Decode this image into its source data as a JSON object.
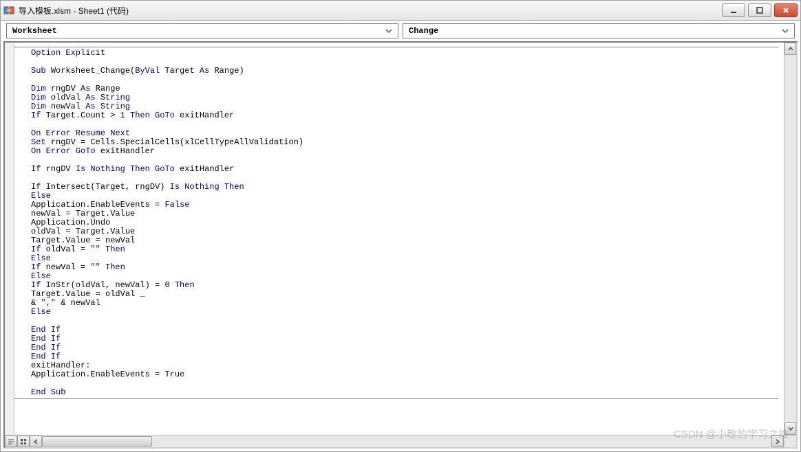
{
  "window": {
    "title": "导入模板.xlsm - Sheet1 (代码)"
  },
  "dropdowns": {
    "object": "Worksheet",
    "procedure": "Change"
  },
  "code": {
    "lines": [
      [
        {
          "t": "Option Explicit",
          "c": "k"
        }
      ],
      [],
      [
        {
          "t": "Sub ",
          "c": "k"
        },
        {
          "t": "Worksheet_Change(",
          "c": "c"
        },
        {
          "t": "ByVal",
          "c": "k"
        },
        {
          "t": " Target ",
          "c": "c"
        },
        {
          "t": "As",
          "c": "k"
        },
        {
          "t": " Range)",
          "c": "c"
        }
      ],
      [],
      [
        {
          "t": "Dim ",
          "c": "k"
        },
        {
          "t": "rngDV ",
          "c": "c"
        },
        {
          "t": "As",
          "c": "k"
        },
        {
          "t": " Range",
          "c": "c"
        }
      ],
      [
        {
          "t": "Dim ",
          "c": "k"
        },
        {
          "t": "oldVal ",
          "c": "c"
        },
        {
          "t": "As String",
          "c": "k"
        }
      ],
      [
        {
          "t": "Dim ",
          "c": "k"
        },
        {
          "t": "newVal ",
          "c": "c"
        },
        {
          "t": "As String",
          "c": "k"
        }
      ],
      [
        {
          "t": "If ",
          "c": "k"
        },
        {
          "t": "Target.Count > 1 ",
          "c": "c"
        },
        {
          "t": "Then GoTo",
          "c": "k"
        },
        {
          "t": " exitHandler",
          "c": "c"
        }
      ],
      [],
      [
        {
          "t": "On Error Resume Next",
          "c": "k"
        }
      ],
      [
        {
          "t": "Set ",
          "c": "k"
        },
        {
          "t": "rngDV = Cells.SpecialCells(xlCellTypeAllValidation)",
          "c": "c"
        }
      ],
      [
        {
          "t": "On Error GoTo",
          "c": "k"
        },
        {
          "t": " exitHandler",
          "c": "c"
        }
      ],
      [],
      [
        {
          "t": "If ",
          "c": "k"
        },
        {
          "t": "rngDV ",
          "c": "c"
        },
        {
          "t": "Is Nothing Then GoTo",
          "c": "k"
        },
        {
          "t": " exitHandler",
          "c": "c"
        }
      ],
      [],
      [
        {
          "t": "If ",
          "c": "k"
        },
        {
          "t": "Intersect(Target, rngDV) ",
          "c": "c"
        },
        {
          "t": "Is Nothing Then",
          "c": "k"
        }
      ],
      [
        {
          "t": "Else",
          "c": "k"
        }
      ],
      [
        {
          "t": "Application.EnableEvents = ",
          "c": "c"
        },
        {
          "t": "False",
          "c": "k"
        }
      ],
      [
        {
          "t": "newVal = Target.Value",
          "c": "c"
        }
      ],
      [
        {
          "t": "Application.Undo",
          "c": "c"
        }
      ],
      [
        {
          "t": "oldVal = Target.Value",
          "c": "c"
        }
      ],
      [
        {
          "t": "Target.Value = newVal",
          "c": "c"
        }
      ],
      [
        {
          "t": "If ",
          "c": "k"
        },
        {
          "t": "oldVal = ",
          "c": "c"
        },
        {
          "t": "\"\"",
          "c": "s"
        },
        {
          "t": " Then",
          "c": "k"
        }
      ],
      [
        {
          "t": "Else",
          "c": "k"
        }
      ],
      [
        {
          "t": "If ",
          "c": "k"
        },
        {
          "t": "newVal = ",
          "c": "c"
        },
        {
          "t": "\"\"",
          "c": "s"
        },
        {
          "t": " Then",
          "c": "k"
        }
      ],
      [
        {
          "t": "Else",
          "c": "k"
        }
      ],
      [
        {
          "t": "If ",
          "c": "k"
        },
        {
          "t": "InStr(oldVal, newVal) = 0 ",
          "c": "c"
        },
        {
          "t": "Then",
          "c": "k"
        }
      ],
      [
        {
          "t": "Target.Value = oldVal _",
          "c": "c"
        }
      ],
      [
        {
          "t": "& ",
          "c": "c"
        },
        {
          "t": "\",\"",
          "c": "s"
        },
        {
          "t": " & newVal",
          "c": "c"
        }
      ],
      [
        {
          "t": "Else",
          "c": "k"
        }
      ],
      [],
      [
        {
          "t": "End If",
          "c": "k"
        }
      ],
      [
        {
          "t": "End If",
          "c": "k"
        }
      ],
      [
        {
          "t": "End If",
          "c": "k"
        }
      ],
      [
        {
          "t": "End If",
          "c": "k"
        }
      ],
      [
        {
          "t": "exitHandler:",
          "c": "c"
        }
      ],
      [
        {
          "t": "Application.EnableEvents = ",
          "c": "c"
        },
        {
          "t": "True",
          "c": "k"
        }
      ],
      [],
      [
        {
          "t": "End Sub",
          "c": "k"
        }
      ]
    ]
  },
  "watermark": "CSDN @小敬的学习之旅"
}
